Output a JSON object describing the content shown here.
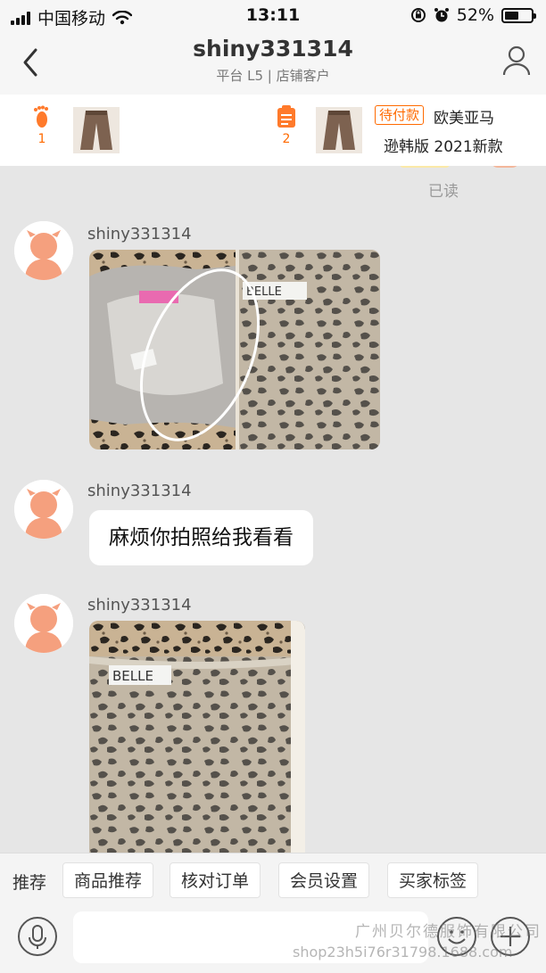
{
  "status_bar": {
    "carrier": "中国移动",
    "time": "13:11",
    "battery_percent": "52%",
    "battery_level": 0.52,
    "icons": [
      "signal-icon",
      "wifi-icon",
      "screen-lock-icon",
      "alarm-icon",
      "battery-icon"
    ]
  },
  "header": {
    "title": "shiny331314",
    "subtitle": "平台 L5 | 店铺客户",
    "left_icon": "chevron-left-icon",
    "right_icon": "user-profile-icon"
  },
  "order_strip": {
    "footprint_count": "1",
    "order_count": "2",
    "tag": "待付款",
    "product_title_line1": "欧美亚马",
    "product_title_line2": "逊韩版 2021新款"
  },
  "chat": {
    "read_status": "已读",
    "messages": [
      {
        "sender": "shiny331314",
        "type": "image",
        "image_text": "BELLE"
      },
      {
        "sender": "shiny331314",
        "type": "text",
        "text": "麻烦你拍照给我看看"
      },
      {
        "sender": "shiny331314",
        "type": "image",
        "image_text": "BELLE"
      }
    ]
  },
  "quick_actions": {
    "label": "推荐",
    "buttons": [
      "商品推荐",
      "核对订单",
      "会员设置",
      "买家标签"
    ]
  },
  "input_bar": {
    "icons": [
      "microphone-icon",
      "emoji-icon",
      "plus-icon"
    ]
  },
  "watermark": {
    "line1": "广州贝尔德服饰有限公司",
    "line2": "shop23h5i76r31798.1688.com"
  },
  "colors": {
    "accent_orange": "#ff6a00",
    "chat_background": "#e6e6e6",
    "bubble": "#ffffff"
  }
}
